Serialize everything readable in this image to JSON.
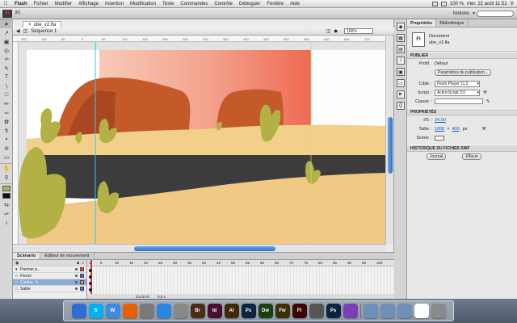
{
  "menubar": {
    "items": [
      "Flash",
      "Fichier",
      "Modifier",
      "Affichage",
      "Insertion",
      "Modification",
      "Texte",
      "Commandes",
      "Contrôle",
      "Déboguer",
      "Fenêtre",
      "Aide"
    ],
    "battery": "100 %",
    "clock": "mer. 22 août  11:52"
  },
  "app": {
    "title": "Fl",
    "workspace": "Notions"
  },
  "document": {
    "tab_name": "ube_v2.fla",
    "scene": "Séquence 1",
    "zoom": "100%",
    "ruler_marks": [
      "150",
      "100",
      "50",
      "0",
      "50",
      "100",
      "150",
      "200",
      "250",
      "300",
      "350",
      "400",
      "450",
      "500",
      "550",
      "600",
      "650",
      "700"
    ]
  },
  "properties": {
    "tabs": [
      "Propriétés",
      "Bibliothèque"
    ],
    "doc_type": "Document",
    "doc_name": "ube_v2.fla",
    "publish_header": "PUBLIER",
    "profile_label": "Profil :",
    "profile_value": "Défaut",
    "publish_settings_button": "Paramètres de publication...",
    "target_label": "Cible :",
    "target_value": "Flash Player 11.2",
    "script_label": "Script :",
    "script_value": "ActionScript 3.0",
    "class_label": "Classe :",
    "props_header": "PROPRIÉTÉS",
    "fps_label": "I/S :",
    "fps_value": "24,00",
    "size_label": "Taille :",
    "width_value": "1000",
    "height_value": "400",
    "unit": "px",
    "stage_label": "Scène :",
    "history_header": "HISTORIQUE DU FICHIER SWF",
    "journal_button": "Journal",
    "clear_button": "Effacer"
  },
  "timeline": {
    "tabs": [
      "Scénario",
      "Éditeur de mouvement"
    ],
    "layers": [
      {
        "name": "Premier p...",
        "color": "#ff3b3b",
        "selected": false
      },
      {
        "name": "Fleurs",
        "color": "#3b6bff",
        "selected": false
      },
      {
        "name": "Cactus",
        "color": "#ff8a3b",
        "selected": true
      },
      {
        "name": "Sable",
        "color": "#3b6bff",
        "selected": false
      }
    ],
    "frame_numbers": [
      "1",
      "5",
      "10",
      "15",
      "20",
      "25",
      "30",
      "35",
      "40",
      "45",
      "50",
      "55",
      "60",
      "65",
      "70",
      "75",
      "80",
      "85",
      "90",
      "95",
      "100"
    ],
    "status_fps": "24,00 i/s",
    "status_time": "0,0 s"
  },
  "dock": {
    "apps": [
      {
        "label": "",
        "color": "#2b6fd6",
        "name": "finder-icon"
      },
      {
        "label": "S",
        "color": "#00aff0",
        "name": "skype-icon"
      },
      {
        "label": "W",
        "color": "#3d8be0",
        "name": "word-icon"
      },
      {
        "label": "",
        "color": "#e66000",
        "name": "firefox-icon"
      },
      {
        "label": "",
        "color": "#7a7a7a",
        "name": "photos-icon"
      },
      {
        "label": "",
        "color": "#2b86e0",
        "name": "itunes-icon"
      },
      {
        "label": "",
        "color": "#888888",
        "name": "calendar-icon"
      },
      {
        "label": "Br",
        "color": "#4a2c12",
        "name": "bridge-icon"
      },
      {
        "label": "Id",
        "color": "#4a0f2f",
        "name": "indesign-icon"
      },
      {
        "label": "Ai",
        "color": "#3d2a06",
        "name": "illustrator-icon"
      },
      {
        "label": "Ps",
        "color": "#0c2342",
        "name": "photoshop-icon"
      },
      {
        "label": "Dw",
        "color": "#1b3d12",
        "name": "dreamweaver-icon"
      },
      {
        "label": "Fw",
        "color": "#3d2e05",
        "name": "fireworks-icon"
      },
      {
        "label": "Fl",
        "color": "#3d0606",
        "name": "flash-icon"
      },
      {
        "label": "",
        "color": "#555555",
        "name": "utility-icon"
      },
      {
        "label": "Ps",
        "color": "#0c2342",
        "name": "photoshop-2-icon"
      },
      {
        "label": "",
        "color": "#7b3fb3",
        "name": "media-icon"
      },
      {
        "label": "",
        "color": "#6d8fb8",
        "name": "folder-icon"
      },
      {
        "label": "",
        "color": "#6d8fb8",
        "name": "documents-icon"
      },
      {
        "label": "",
        "color": "#6d8fb8",
        "name": "downloads-icon"
      },
      {
        "label": "",
        "color": "#ffffff",
        "name": "image-icon"
      },
      {
        "label": "",
        "color": "#8a8a8a",
        "name": "trash-icon"
      }
    ]
  }
}
